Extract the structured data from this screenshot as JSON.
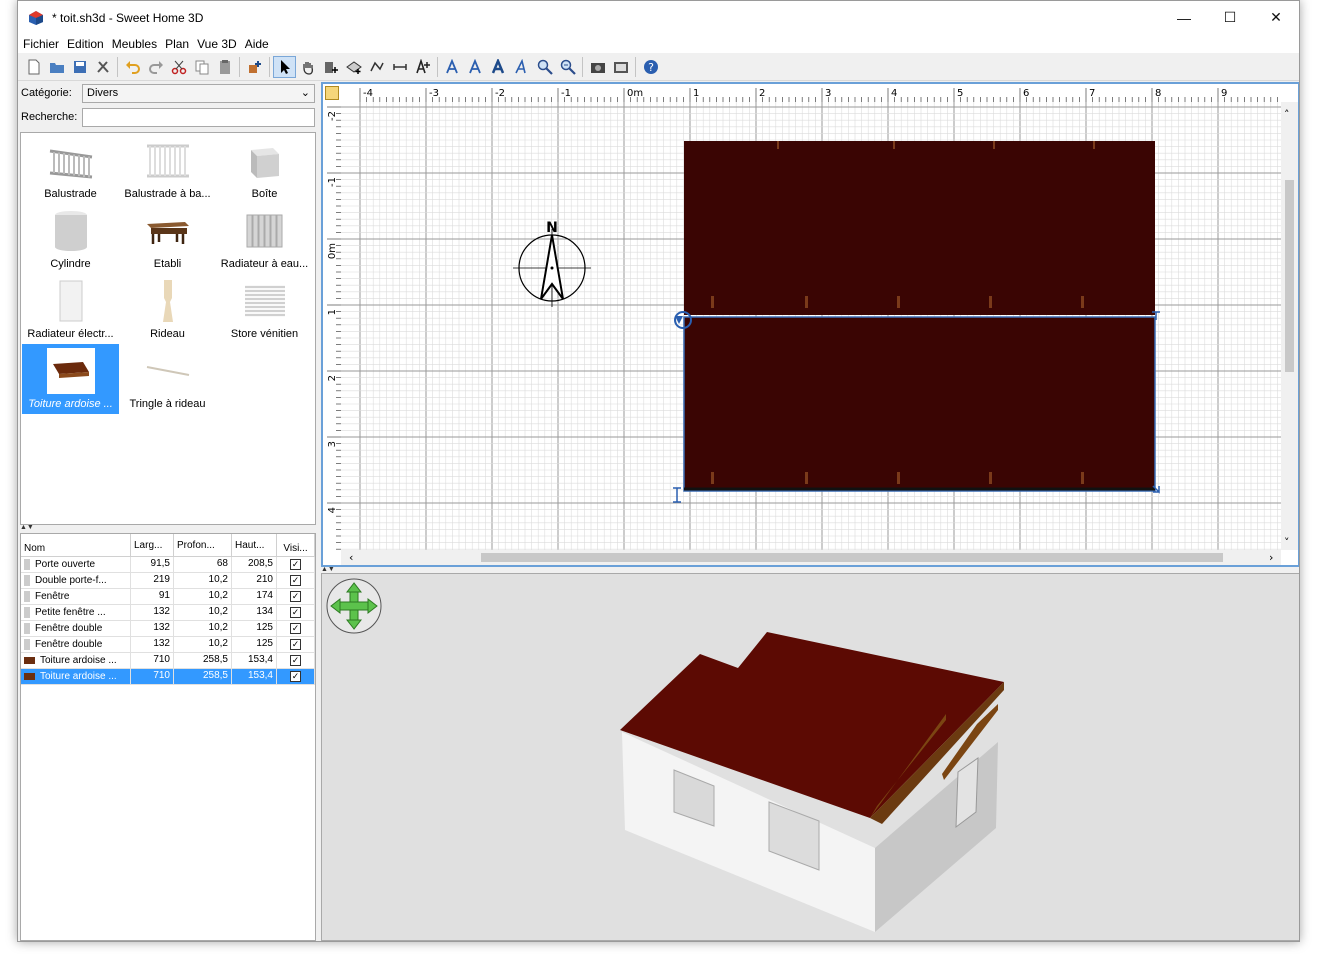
{
  "window": {
    "title": "* toit.sh3d - Sweet Home 3D",
    "controls": {
      "minimize": "—",
      "maximize": "☐",
      "close": "✕"
    }
  },
  "menu": [
    "Fichier",
    "Edition",
    "Meubles",
    "Plan",
    "Vue 3D",
    "Aide"
  ],
  "catalog": {
    "category_label": "Catégorie:",
    "category_value": "Divers",
    "search_label": "Recherche:",
    "search_value": "",
    "items": [
      {
        "label": "Balustrade"
      },
      {
        "label": "Balustrade à ba..."
      },
      {
        "label": "Boîte"
      },
      {
        "label": "Cylindre"
      },
      {
        "label": "Etabli"
      },
      {
        "label": "Radiateur à eau..."
      },
      {
        "label": "Radiateur électr..."
      },
      {
        "label": "Rideau"
      },
      {
        "label": "Store vénitien"
      },
      {
        "label": "Toiture ardoise ...",
        "selected": true
      },
      {
        "label": "Tringle à rideau"
      }
    ]
  },
  "furniture": {
    "headers": {
      "nom": "Nom",
      "larg": "Larg...",
      "prof": "Profon...",
      "haut": "Haut...",
      "vis": "Visi..."
    },
    "rows": [
      {
        "nom": "Porte ouverte",
        "larg": "91,5",
        "prof": "68",
        "haut": "208,5",
        "vis": "✓"
      },
      {
        "nom": "Double porte-f...",
        "larg": "219",
        "prof": "10,2",
        "haut": "210",
        "vis": "✓"
      },
      {
        "nom": "Fenêtre",
        "larg": "91",
        "prof": "10,2",
        "haut": "174",
        "vis": "✓"
      },
      {
        "nom": "Petite fenêtre ...",
        "larg": "132",
        "prof": "10,2",
        "haut": "134",
        "vis": "✓"
      },
      {
        "nom": "Fenêtre double",
        "larg": "132",
        "prof": "10,2",
        "haut": "125",
        "vis": "✓"
      },
      {
        "nom": "Fenêtre double",
        "larg": "132",
        "prof": "10,2",
        "haut": "125",
        "vis": "✓"
      },
      {
        "nom": "Toiture ardoise ...",
        "larg": "710",
        "prof": "258,5",
        "haut": "153,4",
        "vis": "✓",
        "roof": true
      },
      {
        "nom": "Toiture ardoise ...",
        "larg": "710",
        "prof": "258,5",
        "haut": "153,4",
        "vis": "✓",
        "roof": true,
        "selected": true
      }
    ]
  },
  "plan": {
    "ruler_x": [
      "-4",
      "-3",
      "-2",
      "-1",
      "0m",
      "1",
      "2",
      "3",
      "4",
      "5",
      "6",
      "7",
      "8",
      "9"
    ],
    "ruler_y": [
      "-2",
      "-1",
      "0m",
      "1",
      "2",
      "3",
      "4"
    ],
    "compass_label": "N",
    "scroll_left": "‹",
    "scroll_right": "›",
    "scroll_up": "˄",
    "scroll_down": "˅"
  },
  "colors": {
    "roof_plan": "#3a0503",
    "roof_3d": "#5c0a03",
    "selection": "#3399ff",
    "plan_border": "#6aa0d8"
  }
}
